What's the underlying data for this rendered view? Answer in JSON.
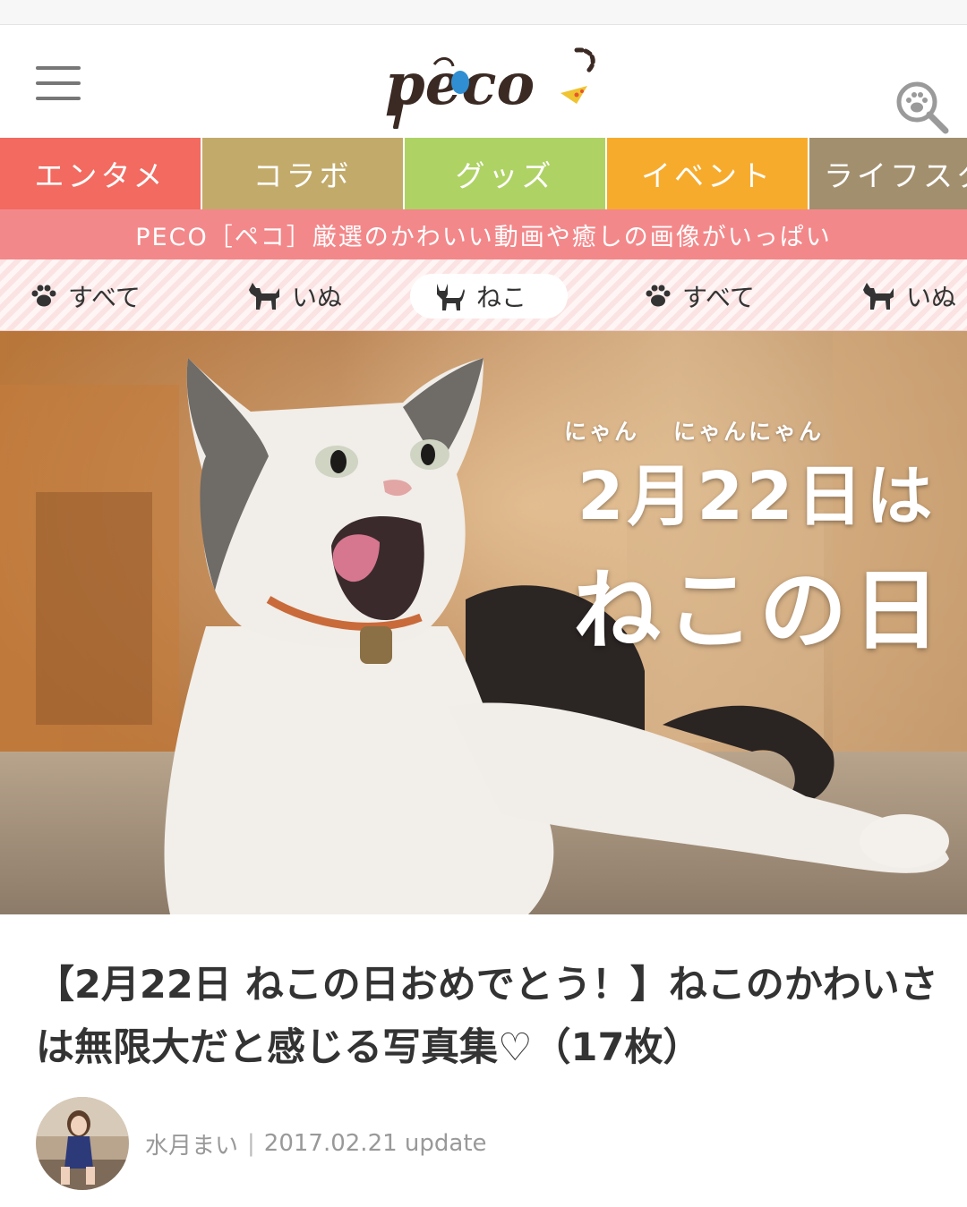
{
  "header": {
    "logo_text": "PECO",
    "menu_icon": "hamburger-menu-icon",
    "search_icon": "paw-search-icon"
  },
  "categories": [
    {
      "label": "エンタメ",
      "color": "#f26a60"
    },
    {
      "label": "コラボ",
      "color": "#c2aa6a"
    },
    {
      "label": "グッズ",
      "color": "#aed264"
    },
    {
      "label": "イベント",
      "color": "#f7ab2c"
    },
    {
      "label": "ライフスタ",
      "color": "#a28f6e"
    }
  ],
  "tagline": "PECO［ペコ］厳選のかわいい動画や癒しの画像がいっぱい",
  "subnav": [
    {
      "label": "すべて",
      "icon": "paw-icon"
    },
    {
      "label": "いぬ",
      "icon": "dog-icon"
    },
    {
      "label": "ねこ",
      "icon": "cat-icon",
      "active": true
    },
    {
      "label": "すべて",
      "icon": "paw-icon"
    },
    {
      "label": "いぬ",
      "icon": "dog-icon"
    }
  ],
  "hero": {
    "ruby_left": "にゃん",
    "ruby_right": "にゃんにゃん",
    "date": "2月22日は",
    "day": "ねこの日"
  },
  "article": {
    "title": "【2月22日 ねこの日おめでとう！】ねこのかわいさは無限大だと感じる写真集♡（17枚）",
    "author": "水月まい",
    "separator": "|",
    "updated": "2017.02.21 update"
  }
}
